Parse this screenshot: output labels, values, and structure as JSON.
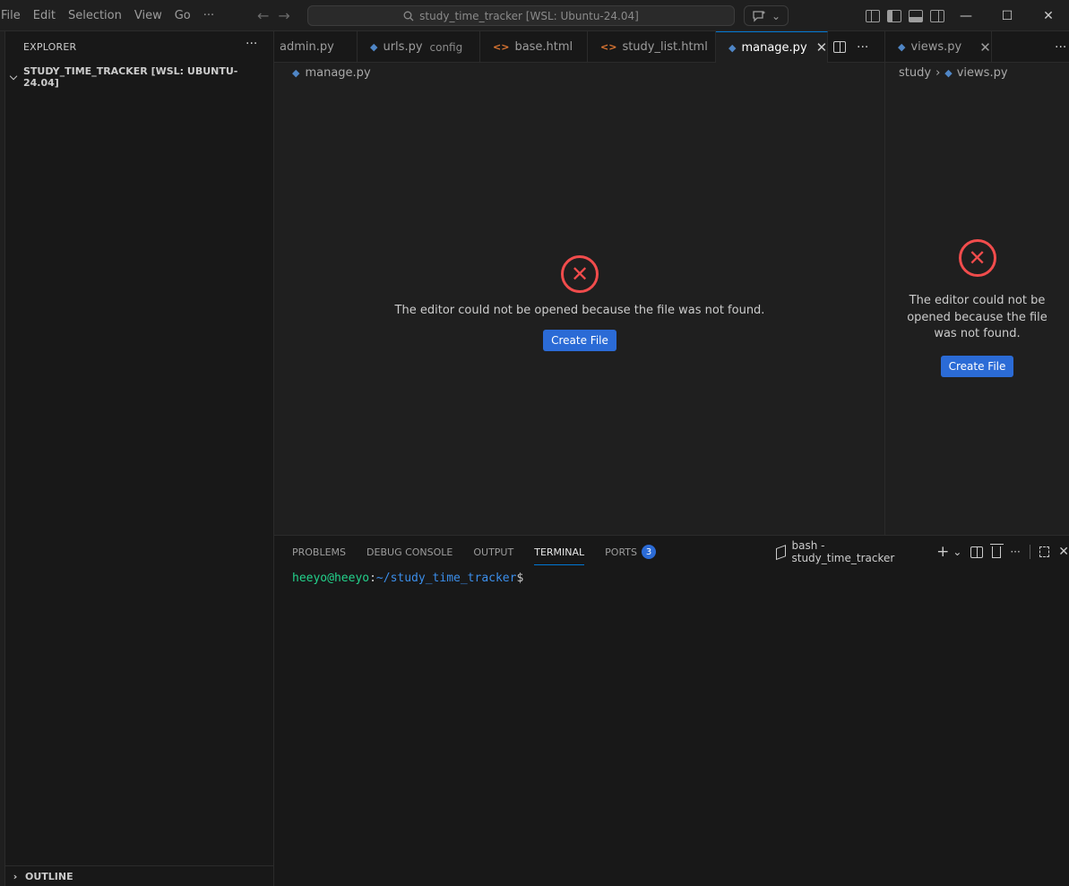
{
  "titlebar": {
    "menu": [
      "File",
      "Edit",
      "Selection",
      "View",
      "Go",
      "···"
    ],
    "search_text": "study_time_tracker [WSL: Ubuntu-24.04]"
  },
  "sidebar": {
    "header": "EXPLORER",
    "more": "···",
    "folder": "STUDY_TIME_TRACKER [WSL: UBUNTU-24.04]",
    "outline": "OUTLINE"
  },
  "editor_group_1": {
    "tabs": [
      {
        "label": "admin.py",
        "desc": "",
        "icon": "none"
      },
      {
        "label": "urls.py",
        "desc": "config",
        "icon": "python-icon"
      },
      {
        "label": "base.html",
        "desc": "",
        "icon": "html-icon"
      },
      {
        "label": "study_list.html",
        "desc": "",
        "icon": "html-icon"
      },
      {
        "label": "manage.py",
        "desc": "",
        "icon": "python-icon",
        "active": true
      }
    ],
    "breadcrumb": "manage.py",
    "error_message": "The editor could not be opened because the file was not found.",
    "button": "Create File"
  },
  "editor_group_2": {
    "tab": "views.py",
    "breadcrumb": [
      "study",
      "views.py"
    ],
    "error_message": "The editor could not be opened because the file was not found.",
    "button": "Create File"
  },
  "panel": {
    "tabs": [
      "PROBLEMS",
      "DEBUG CONSOLE",
      "OUTPUT",
      "TERMINAL",
      "PORTS"
    ],
    "active_tab": "TERMINAL",
    "ports_badge": "3",
    "terminal_session": "bash - study_time_tracker",
    "prompt_user": "heeyo@heeyo",
    "prompt_sep": ":",
    "prompt_path": "~/study_time_tracker",
    "prompt_dollar": "$"
  },
  "colors": {
    "accent": "#0078d4",
    "button": "#2b6bd6",
    "error": "#f14c4c",
    "terminal_user": "#23d18b",
    "terminal_path": "#3b8eea"
  }
}
